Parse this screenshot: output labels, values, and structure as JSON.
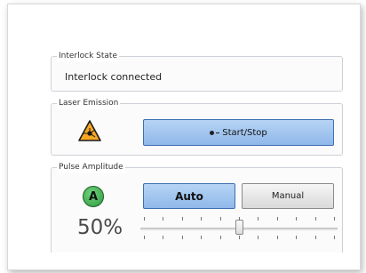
{
  "interlock": {
    "title": "Interlock State",
    "value": "Interlock connected"
  },
  "laser": {
    "title": "Laser Emission",
    "button_label": "Start/Stop",
    "icon": "laser-warning-icon",
    "icon_color": "#f5a623"
  },
  "pulse": {
    "title": "Pulse Amplitude",
    "badge_label": "A",
    "badge_color": "#3fae4f",
    "auto_label": "Auto",
    "manual_label": "Manual",
    "mode_selected": "Auto",
    "percent_text": "50%",
    "slider_value": 0.5
  },
  "colors": {
    "button_blue": "#9ec4ef",
    "button_border": "#3f6fb0"
  }
}
